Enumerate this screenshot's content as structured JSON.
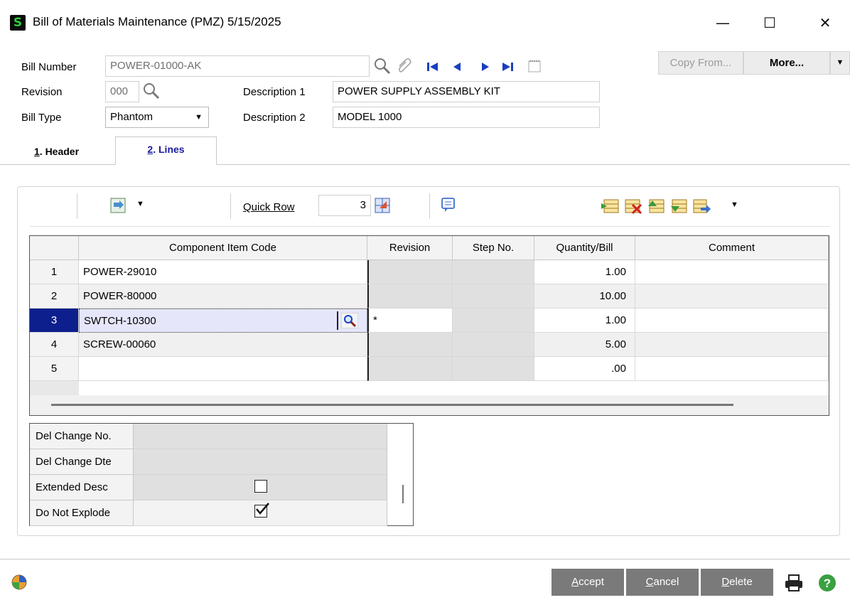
{
  "window": {
    "title": "Bill of Materials Maintenance (PMZ) 5/15/2025",
    "app_icon": "S",
    "minimize": "—",
    "maximize": "☐",
    "close": "✕"
  },
  "header": {
    "bill_number_label": "Bill Number",
    "bill_number_value": "POWER-01000-AK",
    "revision_label": "Revision",
    "revision_value": "000",
    "bill_type_label": "Bill Type",
    "bill_type_value": "Phantom",
    "description1_label": "Description 1",
    "description1_value": "POWER SUPPLY ASSEMBLY KIT",
    "description2_label": "Description 2",
    "description2_value": "MODEL 1000",
    "copy_from_label": "Copy From...",
    "more_label": "More..."
  },
  "tabs": [
    {
      "num": "1",
      "label": ". Header"
    },
    {
      "num": "2",
      "label": ". Lines"
    }
  ],
  "toolbar": {
    "quick_row_label": "Quick Row",
    "quick_row_value": "3"
  },
  "grid": {
    "columns": [
      "Component Item Code",
      "Revision",
      "Step No.",
      "Quantity/Bill",
      "Comment"
    ],
    "rows": [
      {
        "n": "1",
        "item": "POWER-29010",
        "rev": "",
        "step": "",
        "qty": "1.00",
        "comment": ""
      },
      {
        "n": "2",
        "item": "POWER-80000",
        "rev": "",
        "step": "",
        "qty": "10.00",
        "comment": ""
      },
      {
        "n": "3",
        "item": "SWTCH-10300",
        "rev": "*",
        "step": "",
        "qty": "1.00",
        "comment": ""
      },
      {
        "n": "4",
        "item": "SCREW-00060",
        "rev": "",
        "step": "",
        "qty": "5.00",
        "comment": ""
      },
      {
        "n": "5",
        "item": "",
        "rev": "",
        "step": "",
        "qty": ".00",
        "comment": ""
      }
    ]
  },
  "detail": {
    "del_change_no": "Del Change No.",
    "del_change_dte": "Del Change Dte",
    "extended_desc": "Extended Desc",
    "extended_desc_checked": false,
    "do_not_explode": "Do Not Explode",
    "do_not_explode_checked": true
  },
  "footer": {
    "accept_rest": "ccept",
    "accept_key": "A",
    "cancel_key": "C",
    "cancel_rest": "ancel",
    "delete_key": "D",
    "delete_rest": "elete"
  }
}
